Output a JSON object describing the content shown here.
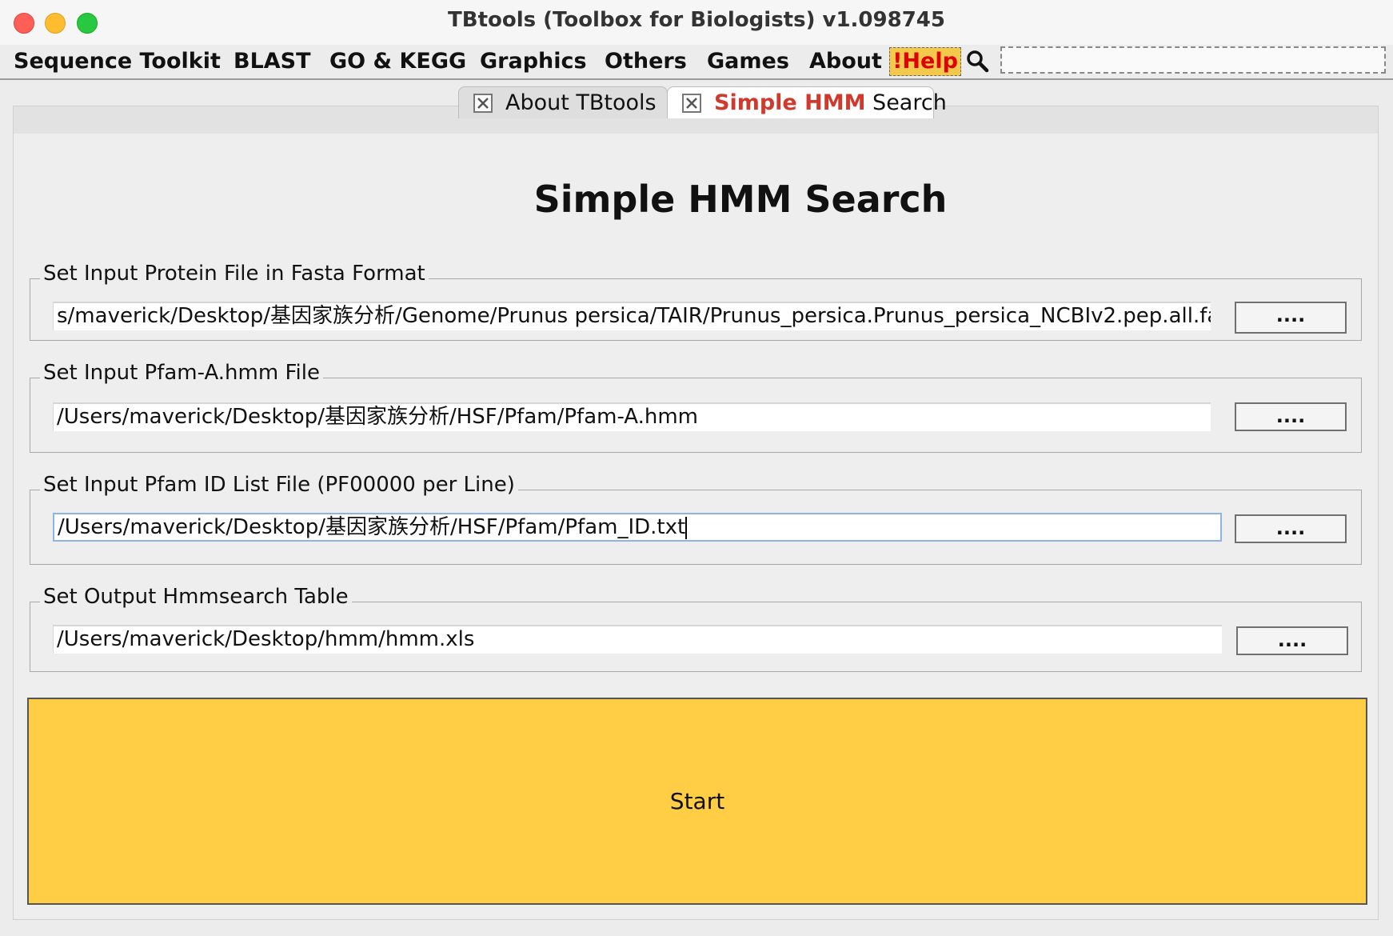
{
  "window": {
    "title": "TBtools (Toolbox for Biologists) v1.098745"
  },
  "menubar": {
    "items": [
      "Sequence Toolkit",
      "BLAST",
      "GO & KEGG",
      "Graphics",
      "Others",
      "Games",
      "About"
    ],
    "help_label": "!Help"
  },
  "tabs": [
    {
      "label": "About TBtools"
    },
    {
      "label_highlight": "Simple HMM",
      "label_rest": " Search"
    }
  ],
  "main": {
    "heading": "Simple HMM Search",
    "groups": [
      {
        "legend": "Set Input Protein File in Fasta Format",
        "value": "s/maverick/Desktop/基因家族分析/Genome/Prunus persica/TAIR/Prunus_persica.Prunus_persica_NCBIv2.pep.all.fa",
        "button": "...."
      },
      {
        "legend": "Set Input Pfam-A.hmm File",
        "value": "/Users/maverick/Desktop/基因家族分析/HSF/Pfam/Pfam-A.hmm",
        "button": "...."
      },
      {
        "legend": "Set Input Pfam ID List File (PF00000 per Line)",
        "value": "/Users/maverick/Desktop/基因家族分析/HSF/Pfam/Pfam_ID.txt",
        "button": "...."
      },
      {
        "legend": "Set Output Hmmsearch Table",
        "value": "/Users/maverick/Desktop/hmm/hmm.xls",
        "button": "...."
      }
    ],
    "start_label": "Start"
  },
  "colors": {
    "start_bg": "#ffce44",
    "help_bg": "#f2c94c",
    "help_text": "#e00000",
    "tab_highlight": "#d0392b"
  }
}
